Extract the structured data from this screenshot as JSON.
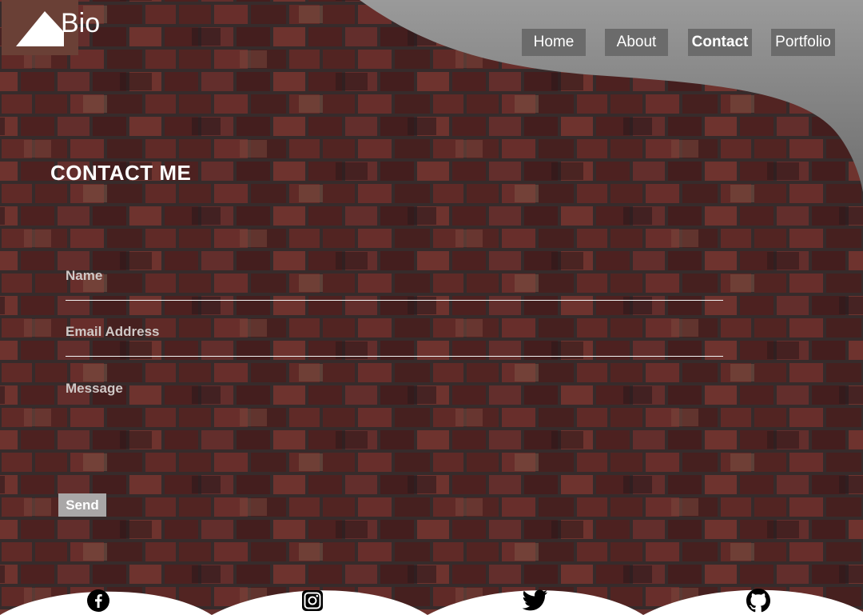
{
  "app": {
    "logo_text": "Bio"
  },
  "nav": {
    "items": [
      {
        "label": "Home",
        "active": false
      },
      {
        "label": "About",
        "active": false
      },
      {
        "label": "Contact",
        "active": true
      },
      {
        "label": "Portfolio",
        "active": false
      }
    ]
  },
  "contact": {
    "title": "CONTACT ME",
    "fields": {
      "name_label": "Name",
      "email_label": "Email Address",
      "message_label": "Message"
    },
    "send_label": "Send"
  },
  "footer": {
    "social_icons": [
      "facebook-icon",
      "instagram-icon",
      "twitter-icon",
      "github-icon"
    ]
  },
  "colors": {
    "brick": "#6a2f2c",
    "mortar": "#3c3030",
    "nav_button": "#6b6b6b",
    "logo_box": "#6a4036",
    "swoosh_gray": "#8f8f8f",
    "send_button": "#a9a7a7"
  }
}
